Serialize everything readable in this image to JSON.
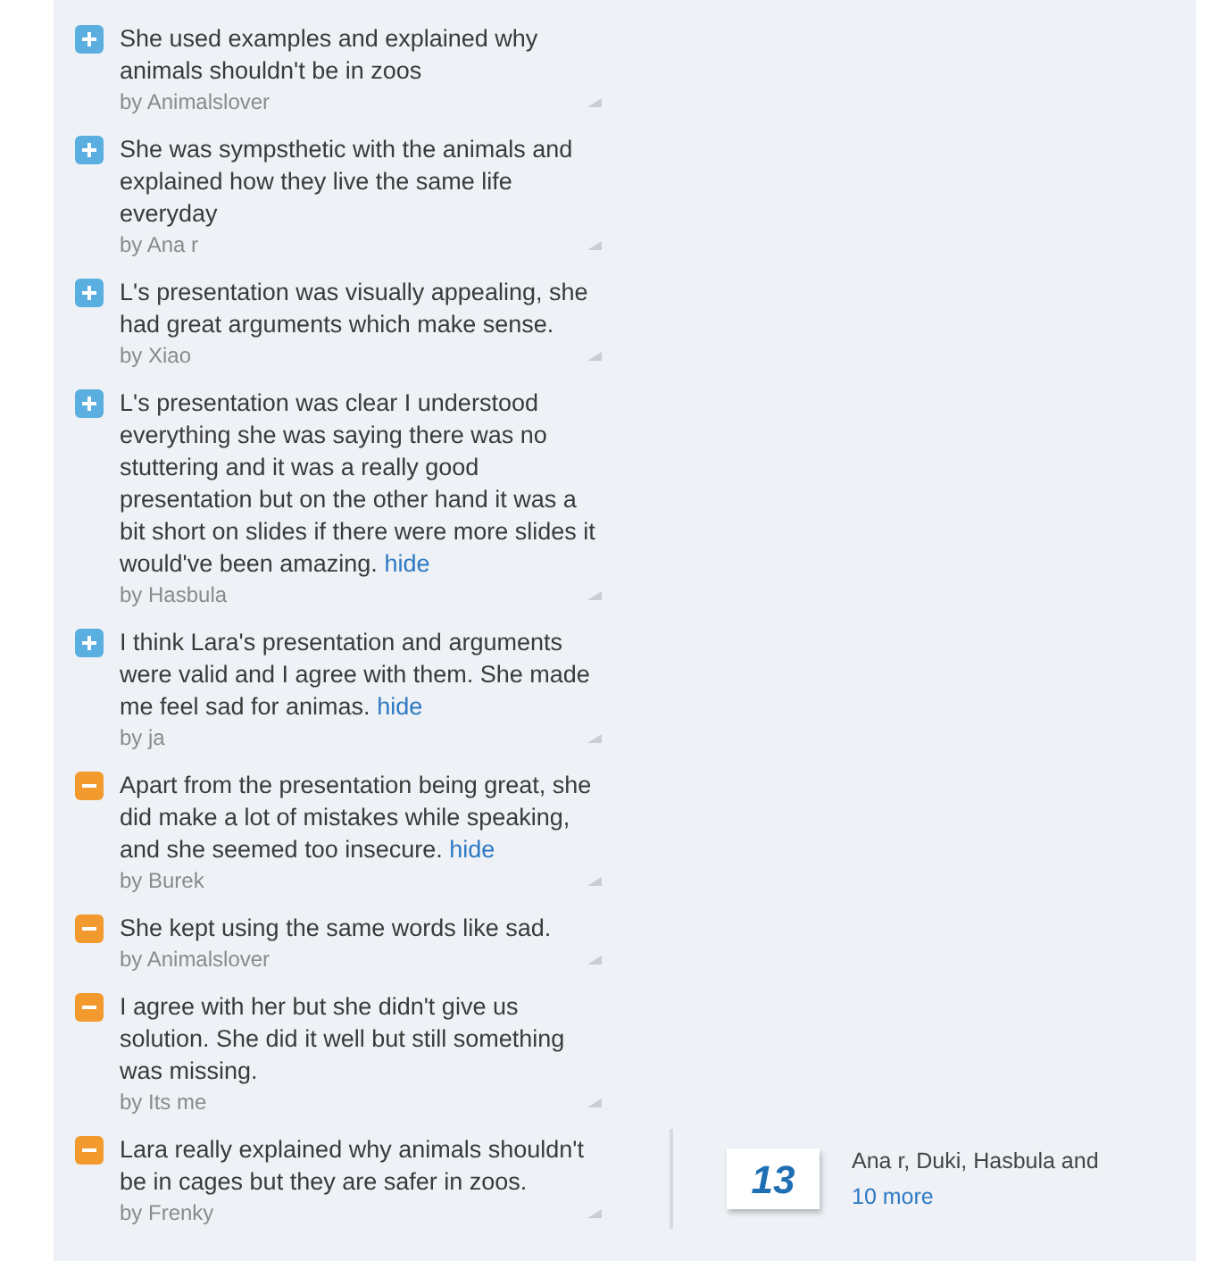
{
  "comments": [
    {
      "kind": "plus",
      "text": "She used examples and explained why animals shouldn't be in zoos",
      "author": "by Animalslover"
    },
    {
      "kind": "plus",
      "text": "She was sympsthetic with the animals and explained how they live the same life everyday",
      "author": "by Ana r"
    },
    {
      "kind": "plus",
      "text": "L's presentation was visually appealing, she had great arguments which make sense.",
      "author": "by Xiao"
    },
    {
      "kind": "plus",
      "text": "L's presentation was clear I understood everything she was saying there was no stuttering and it was a really good presentation but on the other hand it was a bit short on slides if there were more slides it would've been amazing.",
      "hide": "hide",
      "author": "by Hasbula"
    },
    {
      "kind": "plus",
      "text": "I think Lara's presentation and arguments were valid and I agree with them. She made me feel sad for animas.",
      "hide": "hide",
      "author": "by ja"
    },
    {
      "kind": "minus",
      "text": "Apart from the presentation being great, she did make a lot of mistakes while speaking, and she seemed too insecure.",
      "hide": "hide",
      "author": "by Burek"
    },
    {
      "kind": "minus",
      "text": "She kept using the same words like sad.",
      "author": "by Animalslover"
    },
    {
      "kind": "minus",
      "text": "I agree with her but she didn't give us solution. She did it well but still something was missing.",
      "author": "by Its me"
    },
    {
      "kind": "minus",
      "text": "Lara really explained why animals shouldn't be in cages but they are safer in zoos.",
      "author": "by Frenky"
    }
  ],
  "likes": {
    "count": "13",
    "names": "Ana r, Duki, Hasbula and",
    "more": "10 more"
  }
}
